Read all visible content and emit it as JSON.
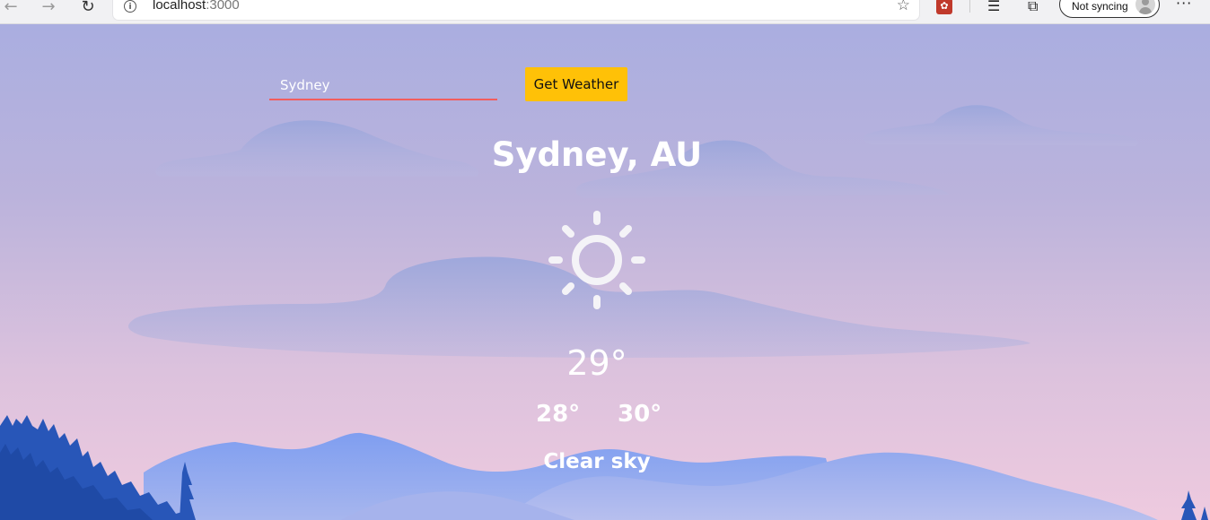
{
  "browser": {
    "url_host": "localhost",
    "url_port": ":3000",
    "sync_label": "Not syncing"
  },
  "search": {
    "value": "Sydney",
    "button_label": "Get Weather"
  },
  "weather": {
    "location": "Sydney, AU",
    "icon": "sun-icon",
    "temperature": "29°",
    "temp_min": "28°",
    "temp_max": "30°",
    "description": "Clear sky"
  },
  "colors": {
    "button": "#ffc107",
    "input_underline": "#f25d5d",
    "sky_top": "#aaaee0",
    "sky_bottom": "#eecadf",
    "mountains": "#7f9ef0",
    "trees": "#2856b8"
  }
}
